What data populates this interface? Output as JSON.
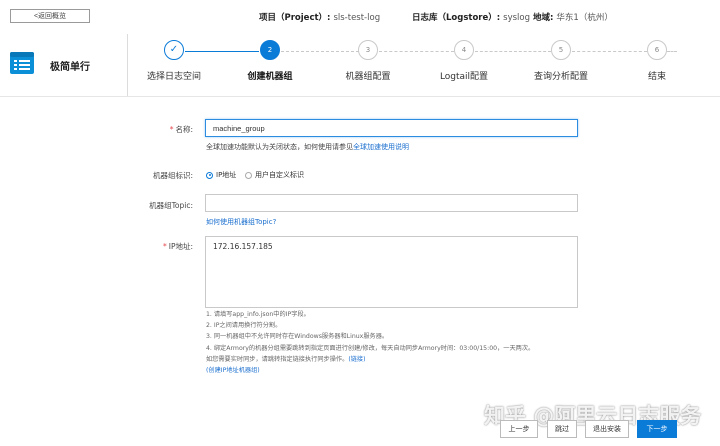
{
  "header": {
    "back_label": "<返回概览",
    "project_label": "项目（Project）:",
    "project_value": "sls-test-log",
    "logstore_label": "日志库（Logstore）:",
    "logstore_value": "syslog",
    "region_label": "地域:",
    "region_value": "华东1（杭州）"
  },
  "brand": {
    "title": "极简单行",
    "icon": "server-list-icon"
  },
  "steps": [
    {
      "num": "✓",
      "label": "选择日志空间",
      "state": "done"
    },
    {
      "num": "2",
      "label": "创建机器组",
      "state": "active"
    },
    {
      "num": "3",
      "label": "机器组配置",
      "state": "pending"
    },
    {
      "num": "4",
      "label": "Logtail配置",
      "state": "pending"
    },
    {
      "num": "5",
      "label": "查询分析配置",
      "state": "pending"
    },
    {
      "num": "6",
      "label": "结束",
      "state": "pending"
    }
  ],
  "form": {
    "name_label": "名称:",
    "name_value": "machine_group",
    "name_help_prefix": "全球加速功能默认为关闭状态，如何使用请参见",
    "name_help_link": "全球加速使用说明",
    "identity_label": "机器组标识:",
    "identity_options": [
      "IP地址",
      "用户自定义标识"
    ],
    "identity_selected": "IP地址",
    "topic_label": "机器组Topic:",
    "topic_value": "",
    "topic_help_link": "如何使用机器组Topic?",
    "ip_label": "IP地址:",
    "ip_value": "172.16.157.185"
  },
  "notes": {
    "line1": "1. 请填写app_info.json中的IP字段。",
    "line2": "2. IP之间请用换行符分割。",
    "line3": "3. 同一机器组中不允许同时存在Windows服务器和Linux服务器。",
    "line4": "4. 绑定Armory的机器分组需要跳转到指定页面进行创建/修改，每天自动同步Armory时间：03:00/15:00，一天两次。",
    "line5_prefix": "如您需要实时同步，请跳转指定链接执行同步操作。",
    "line5_link": "(链接)",
    "line6_link": "(创建IP地址机器组)"
  },
  "buttons": {
    "prev": "上一步",
    "skip": "跳过",
    "exit": "退出安装",
    "next": "下一步"
  },
  "watermark": "知乎 @阿里云日志服务",
  "colors": {
    "accent": "#0b7bd8",
    "required": "#e5484d",
    "link": "#1b6fcf"
  }
}
